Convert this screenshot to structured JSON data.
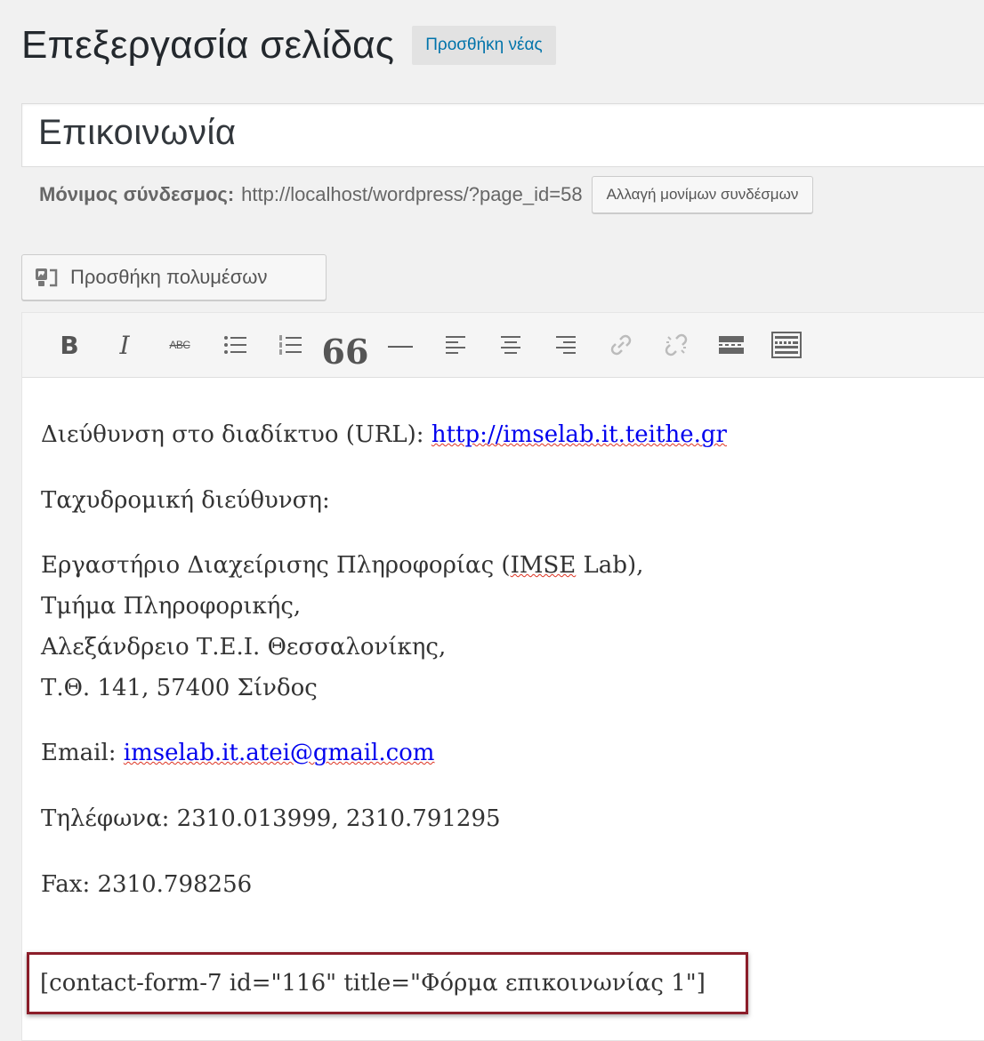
{
  "header": {
    "page_heading": "Επεξεργασία σελίδας",
    "add_new_label": "Προσθήκη νέας"
  },
  "post": {
    "title": "Επικοινωνία"
  },
  "permalink": {
    "label": "Μόνιμος σύνδεσμος:",
    "url": "http://localhost/wordpress/?page_id=58",
    "change_button": "Αλλαγή μονίμων συνδέσμων"
  },
  "media_button": {
    "label": "Προσθήκη πολυμέσων"
  },
  "toolbar": {
    "bold": "B",
    "italic": "I",
    "strikethrough": "ABC",
    "blockquote": "66",
    "horizontal_rule": "—"
  },
  "content": {
    "url_label": "Διεύθυνση στο διαδίκτυο (URL): ",
    "url_link": "http://imselab.it.teithe.gr",
    "postal_label": "Ταχυδρομική διεύθυνση:",
    "address_line1_prefix": "Εργαστήριο Διαχείρισης Πληροφορίας (",
    "address_line1_spell": "IMSE",
    "address_line1_suffix": " Lab),",
    "address_line2": "Τμήμα Πληροφορικής,",
    "address_line3": "Αλεξάνδρειο Τ.Ε.Ι. Θεσσαλονίκης,",
    "address_line4": "Τ.Θ. 141, 57400 Σίνδος",
    "email_label": "Email: ",
    "email_link": "imselab.it.atei@gmail.com",
    "phones": "Τηλέφωνα: 2310.013999, 2310.791295",
    "fax": "Fax: 2310.798256",
    "shortcode": "[contact-form-7 id=\"116\" title=\"Φόρμα επικοινωνίας 1\"]"
  },
  "colors": {
    "link": "#0000ee",
    "accent_blue": "#0073aa",
    "highlight_border": "#8b1e2a"
  }
}
